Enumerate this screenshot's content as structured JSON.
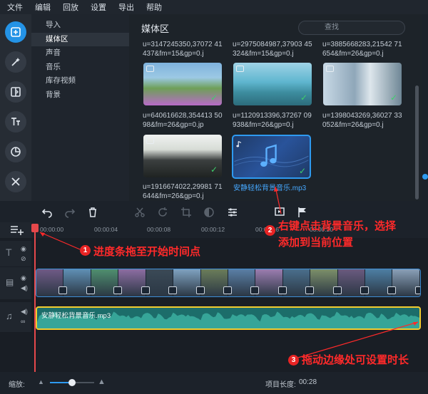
{
  "menu": [
    "文件",
    "编辑",
    "回放",
    "设置",
    "导出",
    "帮助"
  ],
  "sidebar_tools": [
    {
      "icon": "import-icon",
      "active": true
    },
    {
      "icon": "magic-wand-icon",
      "active": false
    },
    {
      "icon": "transitions-icon",
      "active": false
    },
    {
      "icon": "titles-icon",
      "active": false
    },
    {
      "icon": "stickers-icon",
      "active": false
    },
    {
      "icon": "tools-icon",
      "active": false
    }
  ],
  "categories": [
    "导入",
    "媒体区",
    "声音",
    "音乐",
    "库存视频",
    "背景"
  ],
  "selected_category": "媒体区",
  "media": {
    "title": "媒体区",
    "search_placeholder": "查找",
    "top_captions": [
      "u=3147245350,37072 41437&fm=15&gp=0.j",
      "u=2975084987,37903 45324&fm=15&gp=0.j",
      "u=3885668283,21542 71654&fm=26&gp=0.j"
    ],
    "items": [
      {
        "caption": "u=640616628,354413 5098&fm=26&gp=0.jp"
      },
      {
        "caption": "u=1120913396,37267 09938&fm=26&gp=0.j"
      },
      {
        "caption": "u=1398043269,36027 33052&fm=26&gp=0.j"
      },
      {
        "caption": "u=1916674022,29981 71644&fm=26&gp=0.j"
      },
      {
        "caption": "安静轻松背景音乐.mp3"
      }
    ]
  },
  "ruler_ticks": [
    "00:00:00",
    "00:00:04",
    "00:00:08",
    "00:00:12",
    "00:00:16",
    "00:00:20"
  ],
  "audio_clip_label": "安静轻松背景音乐.mp3",
  "status": {
    "zoom_label": "缩放:",
    "zoom_level": 0.5,
    "project_length_label": "项目长度:",
    "project_length": "00:28"
  },
  "annotations": {
    "a1_num": "1",
    "a1_text": "进度条拖至开始时间点",
    "a2_num": "2",
    "a2_text_line1": "右键点击背景音乐，选择",
    "a2_text_line2": "添加到当前位置",
    "a3_num": "3",
    "a3_text": "拖动边缘处可设置时长"
  },
  "colors": {
    "accent": "#2493e6",
    "annotation": "#ff2a2a",
    "audio_track": "#1c6d6a",
    "audio_border": "#f2cc2f"
  }
}
